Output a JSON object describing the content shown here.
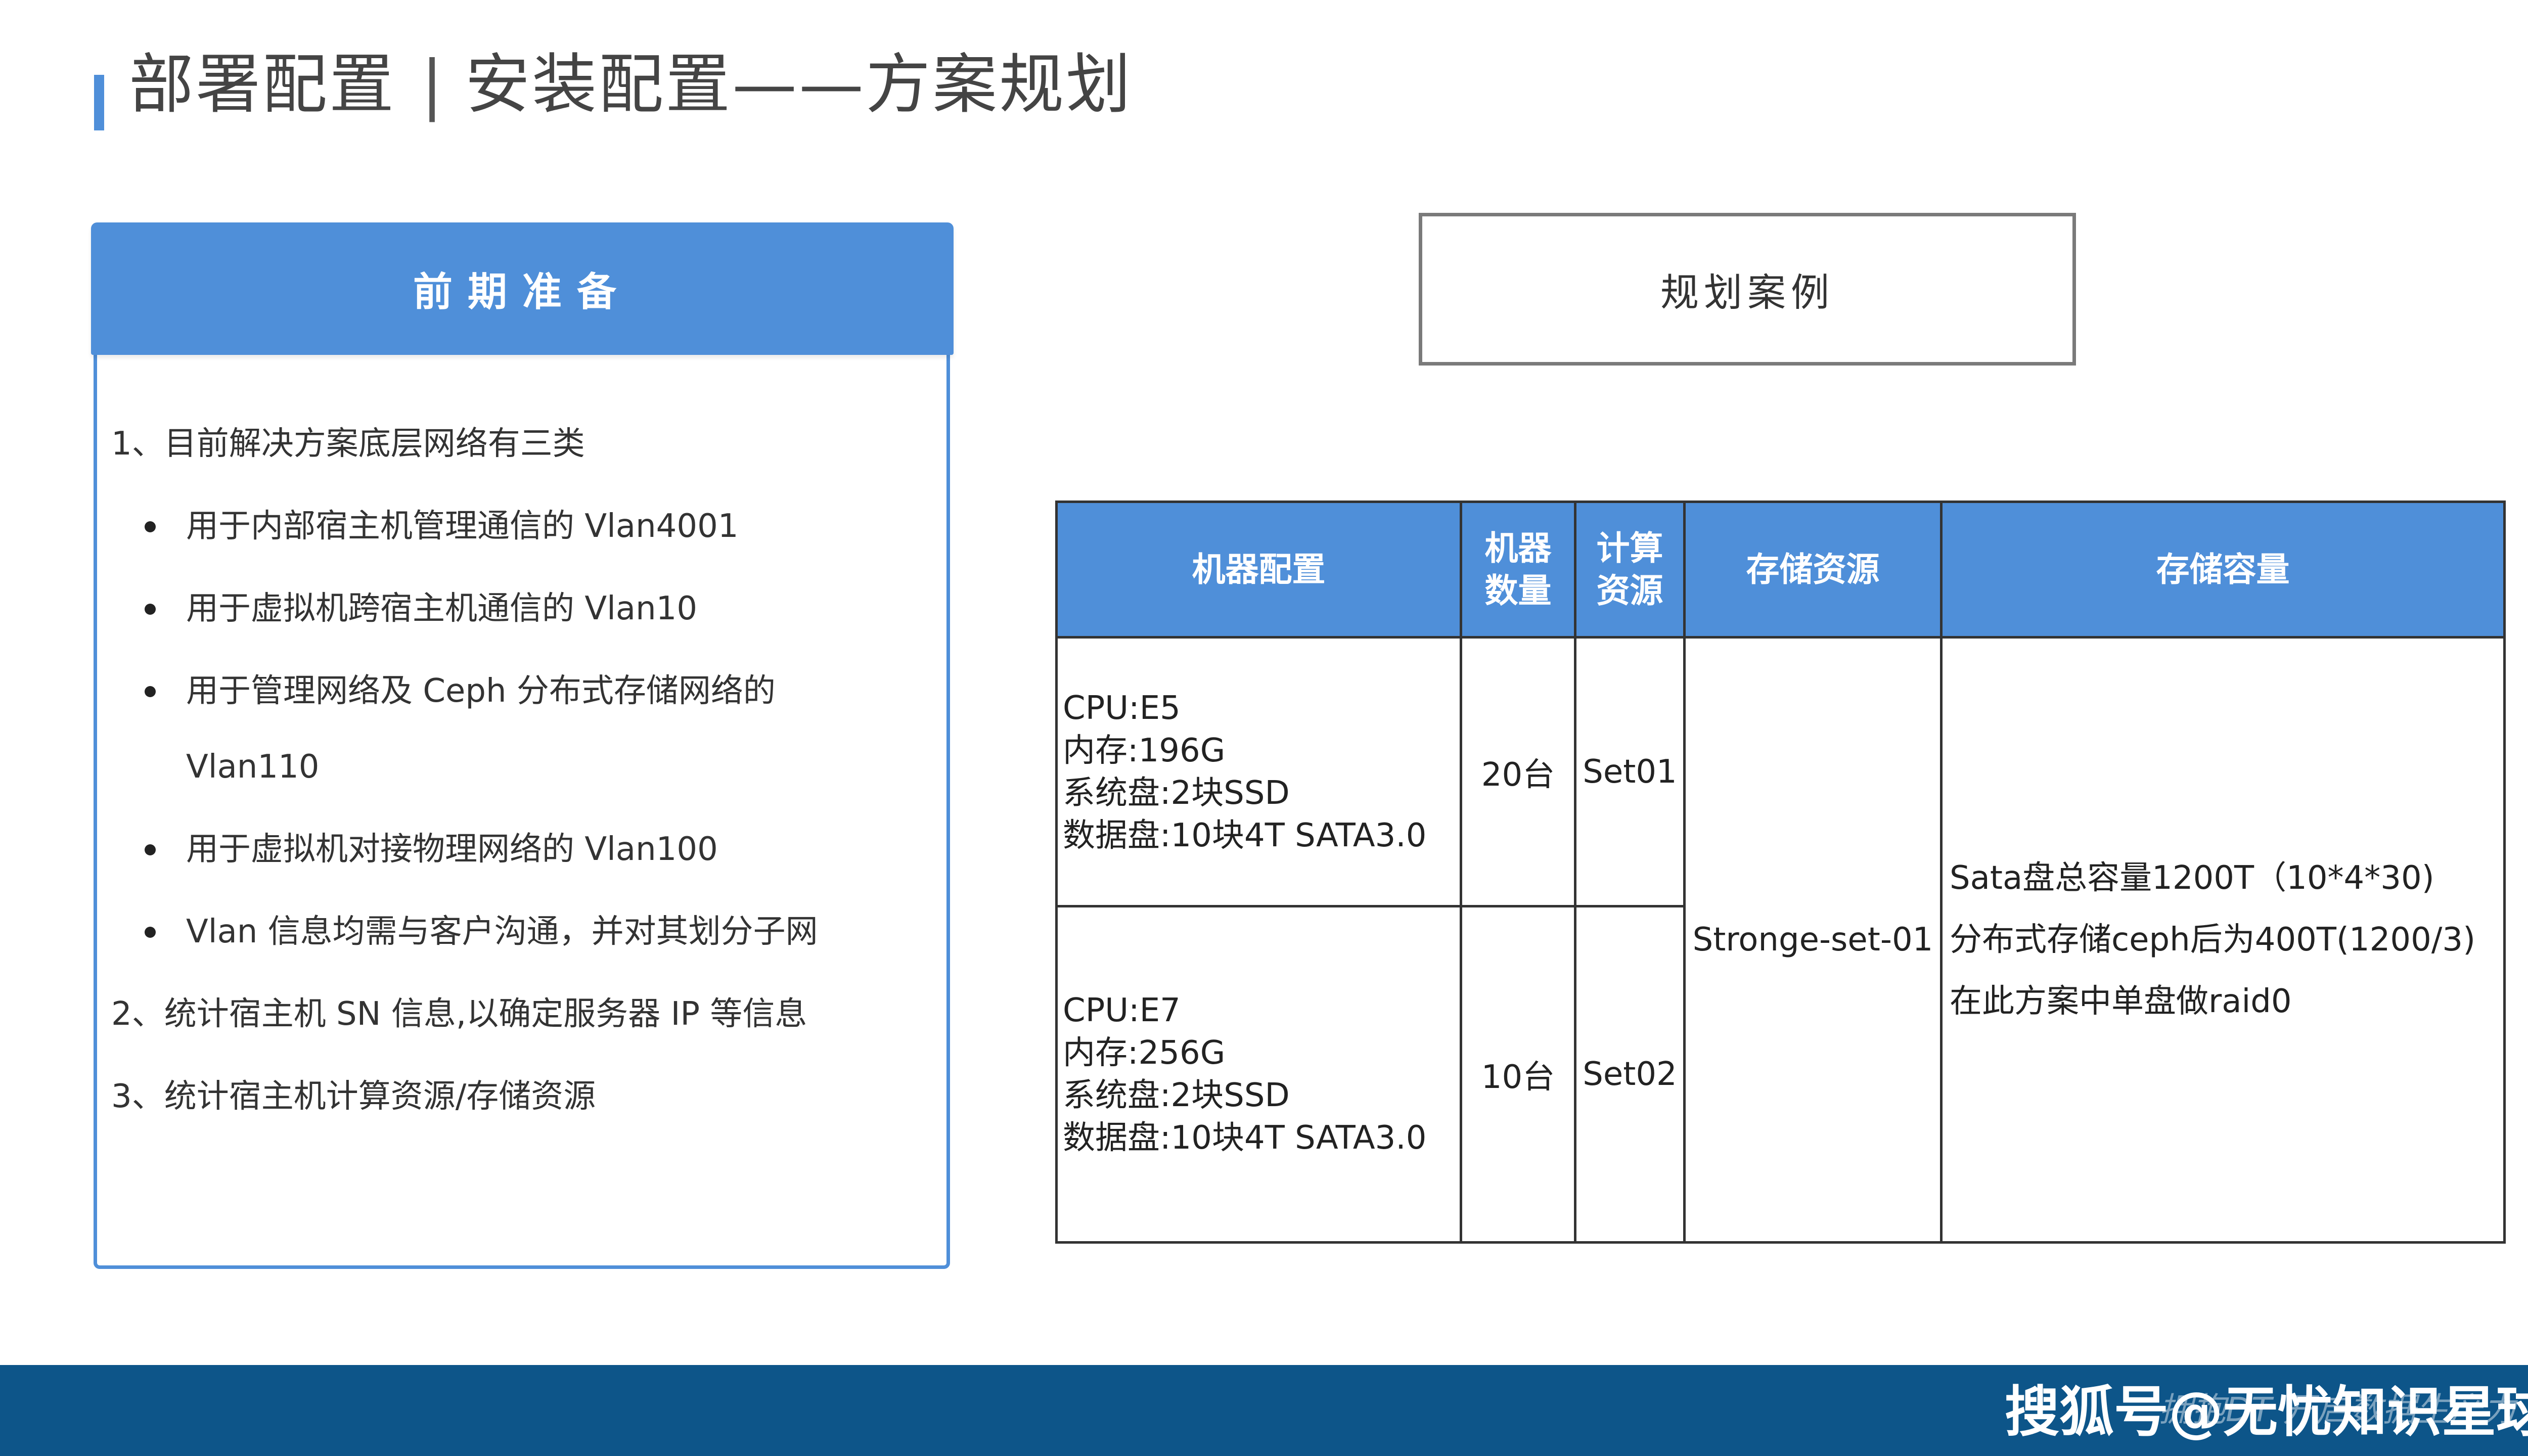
{
  "header": {
    "title_main": "部署配置",
    "title_sep": "|",
    "title_sub": "安装配置——方案规划"
  },
  "prep": {
    "heading": "前期准备",
    "items": [
      "1、目前解决方案底层网络有三类",
      "用于内部宿主机管理通信的 Vlan4001",
      "用于虚拟机跨宿主机通信的 Vlan10",
      "用于管理网络及 Ceph 分布式存储网络的",
      "Vlan110",
      "用于虚拟机对接物理网络的 Vlan100",
      "Vlan 信息均需与客户沟通，并对其划分子网",
      "2、统计宿主机 SN 信息,以确定服务器 IP 等信息",
      "3、统计宿主机计算资源/存储资源"
    ]
  },
  "case": {
    "heading": "规划案例"
  },
  "table": {
    "headers": [
      "机器配置",
      "机器数量",
      "计算资源",
      "存储资源",
      "存储容量"
    ],
    "rows": [
      {
        "config": [
          "CPU:E5",
          "内存:196G",
          "系统盘:2块SSD",
          "数据盘:10块4T SATA3.0"
        ],
        "count": "20台",
        "compute": "Set01"
      },
      {
        "config": [
          "CPU:E7",
          "内存:256G",
          "系统盘:2块SSD",
          "数据盘:10块4T SATA3.0"
        ],
        "count": "10台",
        "compute": "Set02"
      }
    ],
    "storage": "Stronge-set-01",
    "capacity": [
      "Sata盘总容量1200T（10*4*30)",
      "分布式存储ceph后为400T(1200/3)",
      "在此方案中单盘做raid0"
    ]
  },
  "footer": {
    "watermark": "搜狐号@无忧知识星球",
    "slogan": "拥抱DT  开启数据生产力"
  },
  "colors": {
    "accent": "#4f8fd9",
    "footer": "#0d5589"
  }
}
